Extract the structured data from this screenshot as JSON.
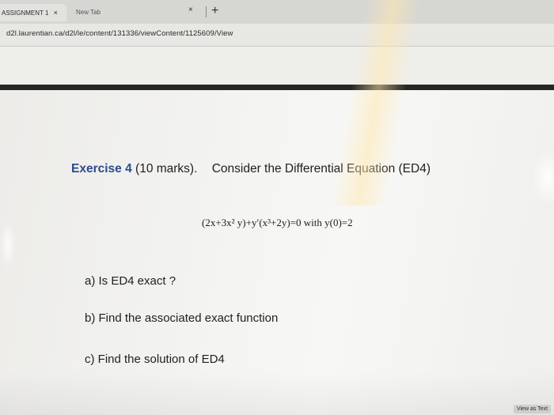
{
  "browser": {
    "tabs": [
      {
        "label": "ASSIGNMENT 1",
        "close": "×"
      },
      {
        "label": "New Tab",
        "close": "×"
      }
    ],
    "new_tab": "+",
    "url": "d2l.laurentian.ca/d2l/le/content/131336/viewContent/1125609/View"
  },
  "document": {
    "exercise": "Exercise 4",
    "marks": "(10 marks).",
    "consider": "Consider the Differential Equation (ED4)",
    "equation": "(2x+3x² y)+y′(x³+2y)=0 with y(0)=2",
    "questions": [
      "a) Is ED4 exact ?",
      "b) Find the associated exact function",
      "c) Find the solution of ED4"
    ]
  },
  "footer": {
    "view_as_text": "View as Text"
  }
}
